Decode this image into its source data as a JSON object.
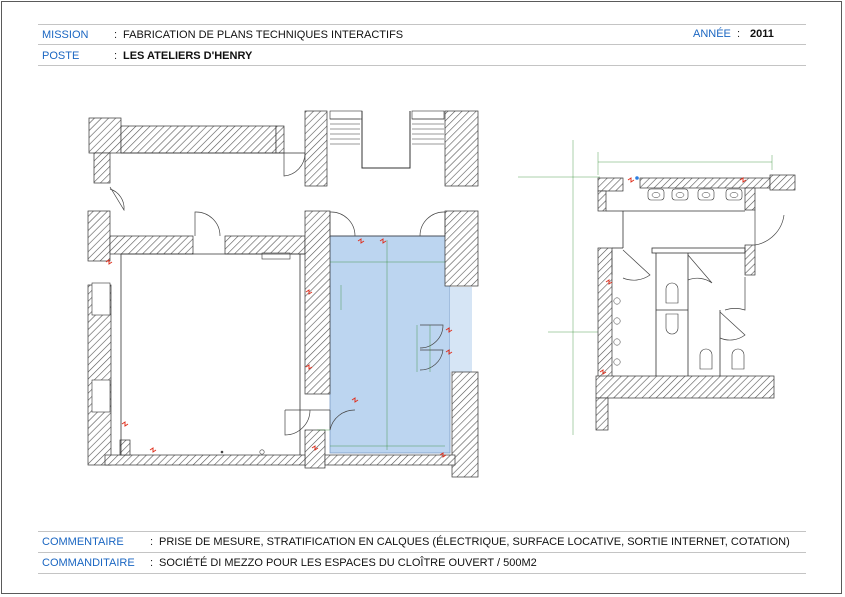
{
  "header": {
    "mission_label": "MISSION",
    "mission_value": "FABRICATION DE PLANS TECHNIQUES INTERACTIFS",
    "year_label": "ANNÉE",
    "year_value": "2011",
    "post_label": "POSTE",
    "post_value": "LES ATELIERS D'HENRY"
  },
  "footer": {
    "comment_label": "COMMENTAIRE",
    "comment_value": "PRISE DE MESURE, STRATIFICATION EN CALQUES (ÉLECTRIQUE, SURFACE LOCATIVE, SORTIE INTERNET, COTATION)",
    "client_label": "COMMANDITAIRE",
    "client_value": "SOCIÉTÉ DI MEZZO POUR LES ESPACES DU CLOÎTRE OUVERT / 500M2"
  },
  "separator": ":",
  "colors": {
    "label_blue": "#1a66c2",
    "highlight_fill": "#bcd5f0",
    "wall_hatch": "#555555",
    "dimension_green": "#2e8b2e",
    "electric_red": "#e0301e"
  },
  "icons": {
    "plan_main": "floor-plan-drawing",
    "plan_side": "restroom-plan-drawing"
  }
}
